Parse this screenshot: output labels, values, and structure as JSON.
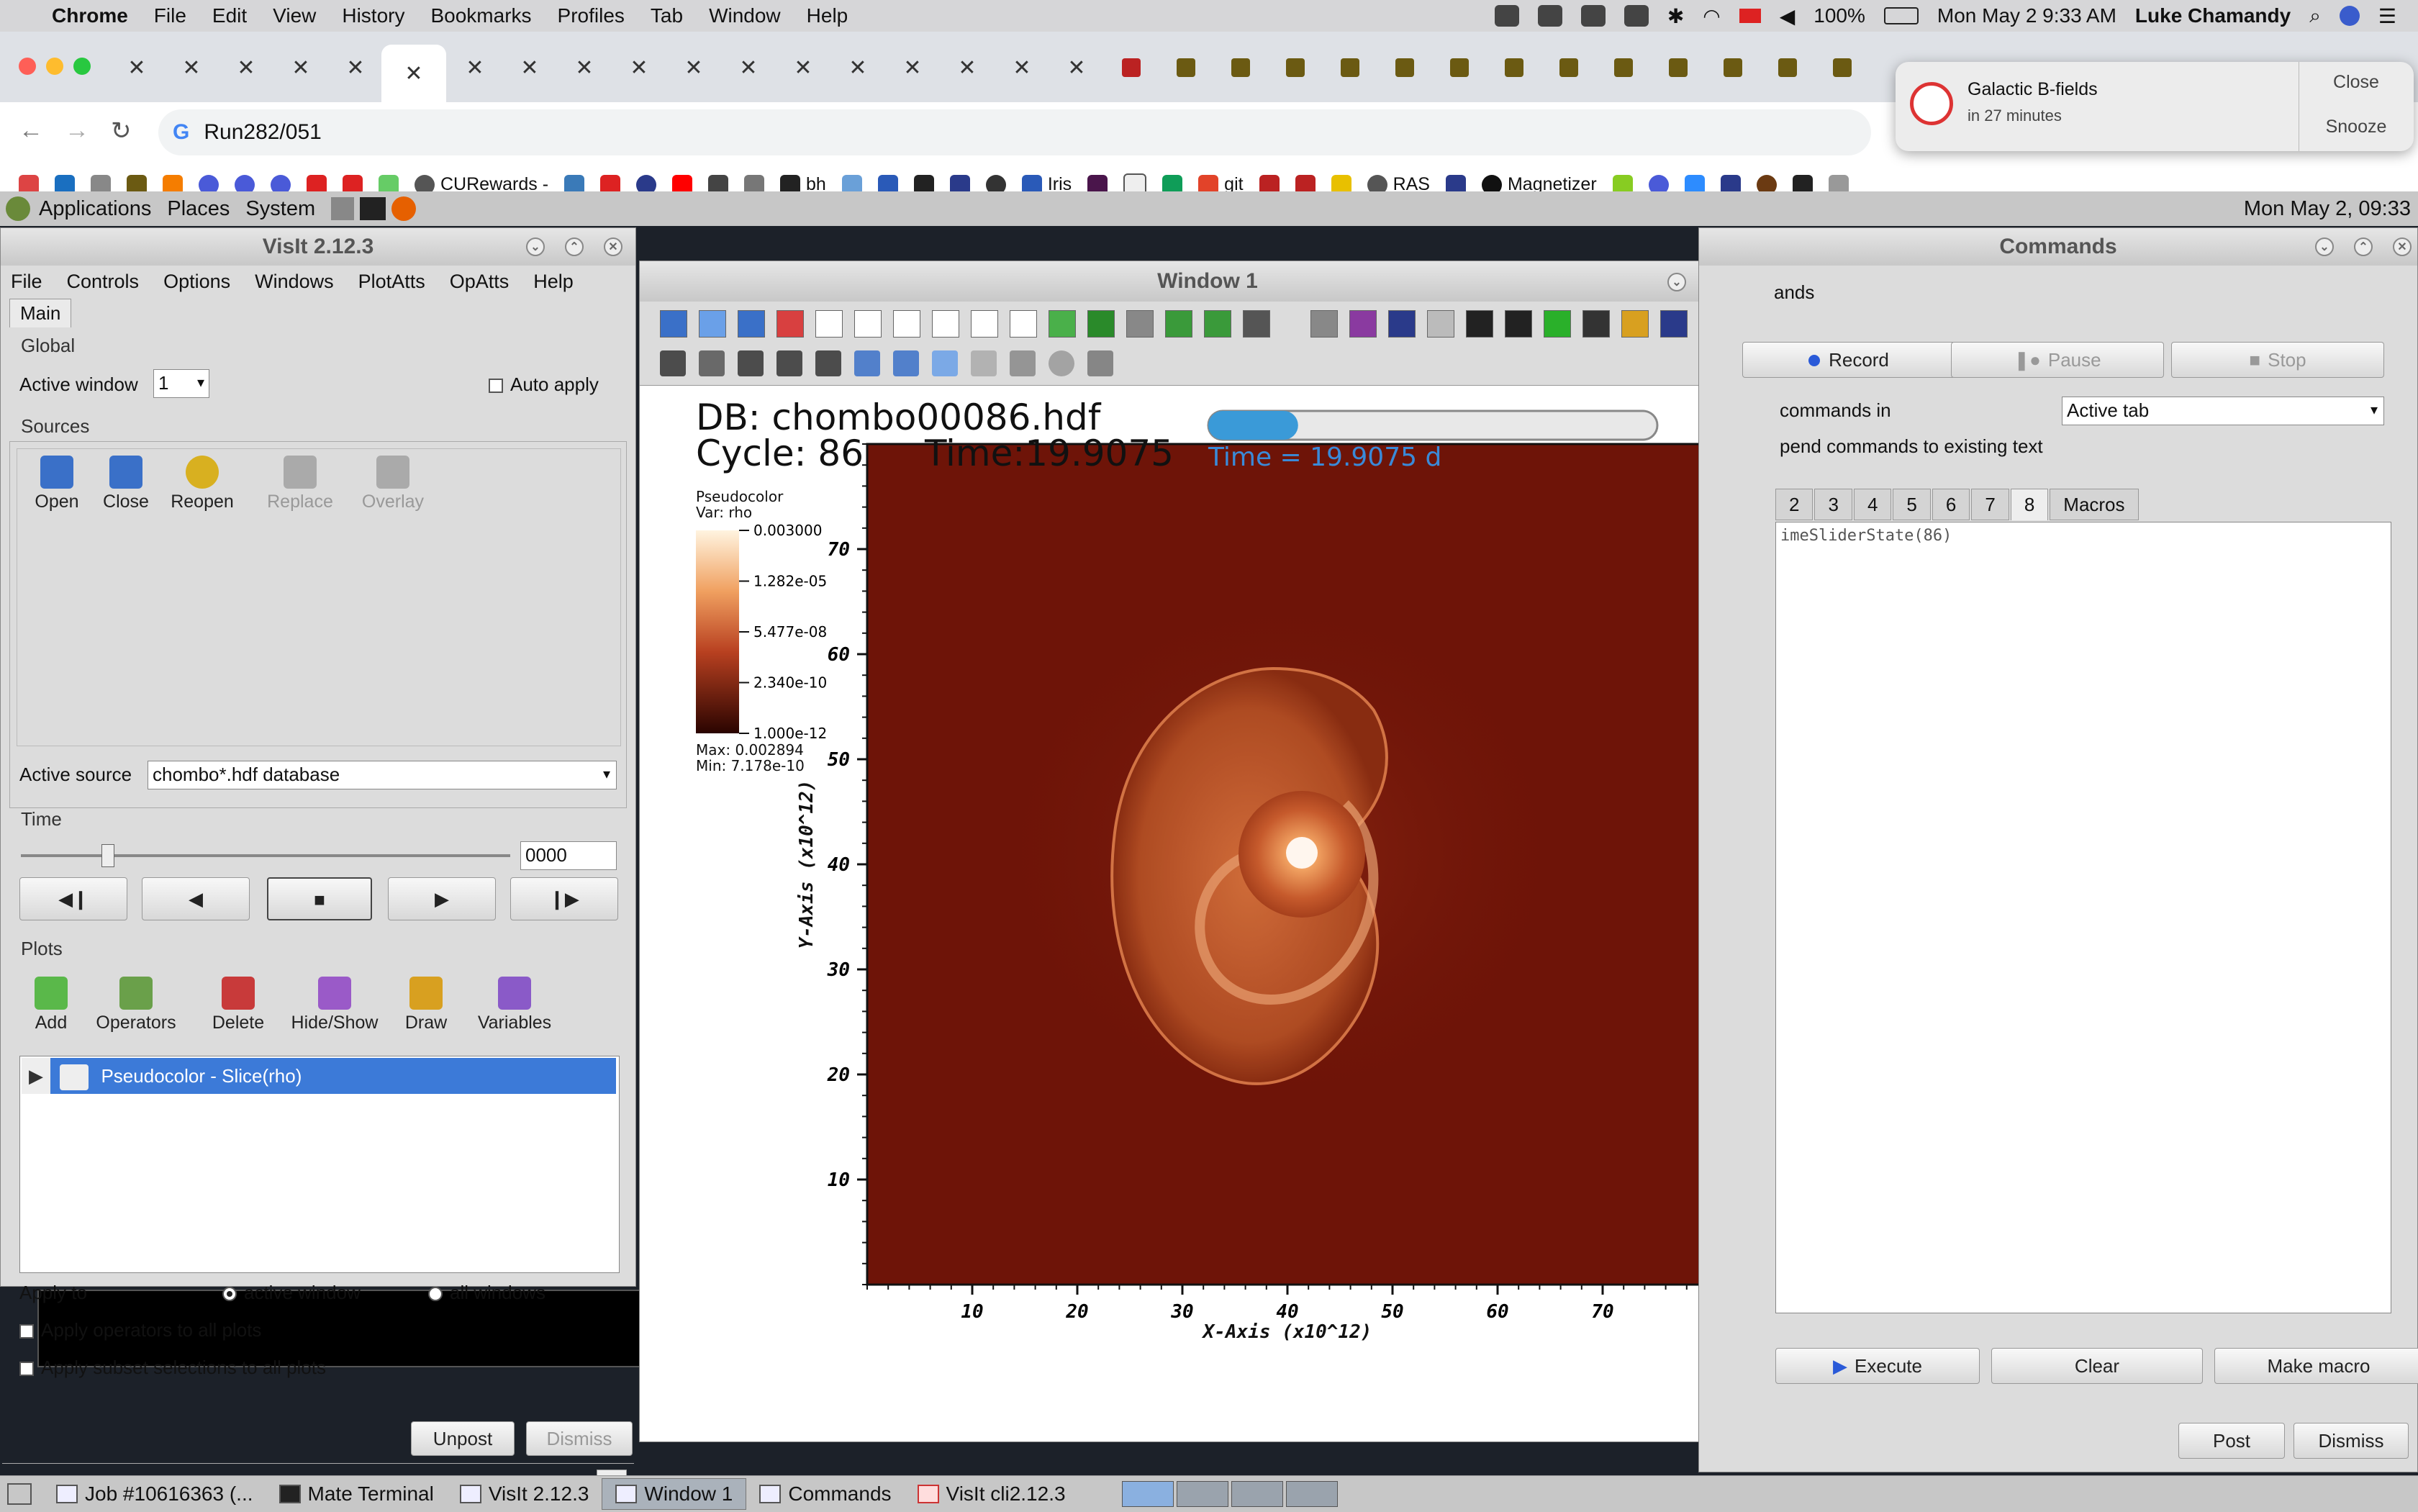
{
  "macos": {
    "menus": [
      "Chrome",
      "File",
      "Edit",
      "View",
      "History",
      "Bookmarks",
      "Profiles",
      "Tab",
      "Window",
      "Help"
    ],
    "battery": "100%",
    "datetime": "Mon May 2  9:33 AM",
    "user": "Luke Chamandy"
  },
  "chrome": {
    "url": "Run282/051",
    "bookmarks": [
      "CURewards -",
      "bh",
      "Iris",
      "git",
      "RAS",
      "Magnetizer"
    ]
  },
  "notification": {
    "title": "Galactic B-fields",
    "subtitle": "in 27 minutes",
    "close": "Close",
    "snooze": "Snooze"
  },
  "gnome": {
    "menus": [
      "Applications",
      "Places",
      "System"
    ],
    "clock": "Mon May  2, 09:33"
  },
  "visit": {
    "title": "VisIt 2.12.3",
    "menu": [
      "File",
      "Controls",
      "Options",
      "Windows",
      "PlotAtts",
      "OpAtts",
      "Help"
    ],
    "tab": "Main",
    "global_label": "Global",
    "active_window_label": "Active window",
    "active_window_value": "1",
    "auto_apply": "Auto apply",
    "sources_label": "Sources",
    "source_tools": [
      "Open",
      "Close",
      "Reopen",
      "Replace",
      "Overlay"
    ],
    "active_source_label": "Active source",
    "active_source_value": "chombo*.hdf database",
    "time_label": "Time",
    "time_value": "0000",
    "plots_label": "Plots",
    "plot_tools": [
      "Add",
      "Operators",
      "Delete",
      "Hide/Show",
      "Draw",
      "Variables"
    ],
    "plot_item": "Pseudocolor - Slice(rho)",
    "apply_to_label": "Apply to",
    "apply_active": "active window",
    "apply_all": "all windows",
    "apply_operators": "Apply operators to all plots",
    "apply_subset": "Apply subset selections to all plots",
    "unpost": "Unpost",
    "dismiss": "Dismiss"
  },
  "window1": {
    "title": "Window 1",
    "db": "DB: chombo00086.hdf",
    "cycle": "Cycle: 86",
    "time_overlay": "Time:19.9075",
    "time_blue": "Time = 19.9075 d",
    "progress": 0.2,
    "legend_title": "Pseudocolor",
    "legend_var": "Var: rho",
    "legend_ticks": [
      "0.003000",
      "1.282e-05",
      "5.477e-08",
      "2.340e-10",
      "1.000e-12"
    ],
    "legend_max": "Max:  0.002894",
    "legend_min": "Min:  7.178e-10",
    "xlabel": "X-Axis  (x10^12)",
    "ylabel": "Y-Axis  (x10^12)",
    "xticks": [
      "10",
      "20",
      "30",
      "40",
      "50",
      "60",
      "70"
    ],
    "yticks": [
      "10",
      "20",
      "30",
      "40",
      "50",
      "60",
      "70"
    ]
  },
  "commands": {
    "title": "Commands",
    "frag_ands": "ands",
    "record": "Record",
    "pause": "Pause",
    "stop": "Stop",
    "commands_in": "commands in",
    "active_tab": "Active tab",
    "append": "pend commands to existing text",
    "tabs": [
      "2",
      "3",
      "4",
      "5",
      "6",
      "7",
      "8",
      "Macros"
    ],
    "code": "imeSliderState(86)",
    "execute": "Execute",
    "clear": "Clear",
    "make_macro": "Make macro",
    "post": "Post",
    "dismiss": "Dismiss"
  },
  "taskbar": [
    "Job #10616363 (...",
    "Mate Terminal",
    "VisIt 2.12.3",
    "Window 1",
    "Commands",
    "VisIt cli2.12.3"
  ]
}
